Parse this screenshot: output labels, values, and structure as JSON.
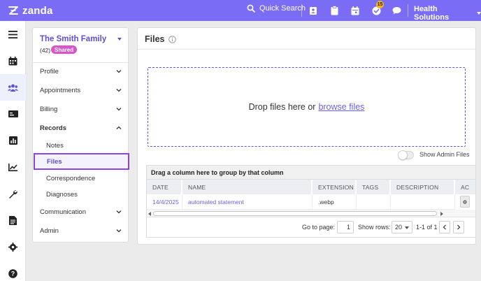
{
  "app": {
    "brand": "zanda",
    "org_name": "Health Solutions"
  },
  "topbar": {
    "quick_search": "Quick Search",
    "icons": [
      "search-icon",
      "contacts-icon",
      "clipboard-icon",
      "calendar-icon",
      "tasks-check-icon",
      "chat-icon"
    ],
    "tasks_badge": "15"
  },
  "rail": {
    "items": [
      "menu-icon",
      "calendar-icon",
      "clients-icon",
      "billing-card-icon",
      "reports-icon",
      "chart-icon",
      "wrench-icon",
      "document-icon",
      "settings-icon",
      "help-icon"
    ],
    "active": "clients-icon"
  },
  "sidebar": {
    "family_name": "The Smith Family",
    "count": "(42)",
    "badge": "Shared",
    "items": [
      {
        "label": "Profile"
      },
      {
        "label": "Appointments"
      },
      {
        "label": "Billing"
      },
      {
        "label": "Records",
        "expanded": true
      },
      {
        "label": "Communication"
      },
      {
        "label": "Admin"
      }
    ],
    "records_sub": [
      {
        "label": "Notes"
      },
      {
        "label": "Files",
        "active": true
      },
      {
        "label": "Correspondence"
      },
      {
        "label": "Diagnoses"
      }
    ]
  },
  "files": {
    "title": "Files",
    "drop_text": "Drop files here or",
    "browse_link": "browse files",
    "toggle_label": "Show Admin Files",
    "toggle_on": false
  },
  "grid": {
    "group_hint": "Drag a column here to group by that column",
    "columns": [
      "DATE",
      "NAME",
      "EXTENSION",
      "TAGS",
      "DESCRIPTION",
      "AC"
    ],
    "rows": [
      {
        "date": "14/4/2025",
        "name": "automated statement",
        "extension": ".webp",
        "tags": "",
        "description": ""
      }
    ]
  },
  "pager": {
    "goto_label": "Go to page:",
    "page": "1",
    "rows_label": "Show rows:",
    "rows_value": "20",
    "range": "1-1 of 1"
  },
  "colors": {
    "brand": "#7b6cf6",
    "accent": "#5b4fd6",
    "badge": "#d856c9",
    "highlight_border": "#8a45e0"
  }
}
